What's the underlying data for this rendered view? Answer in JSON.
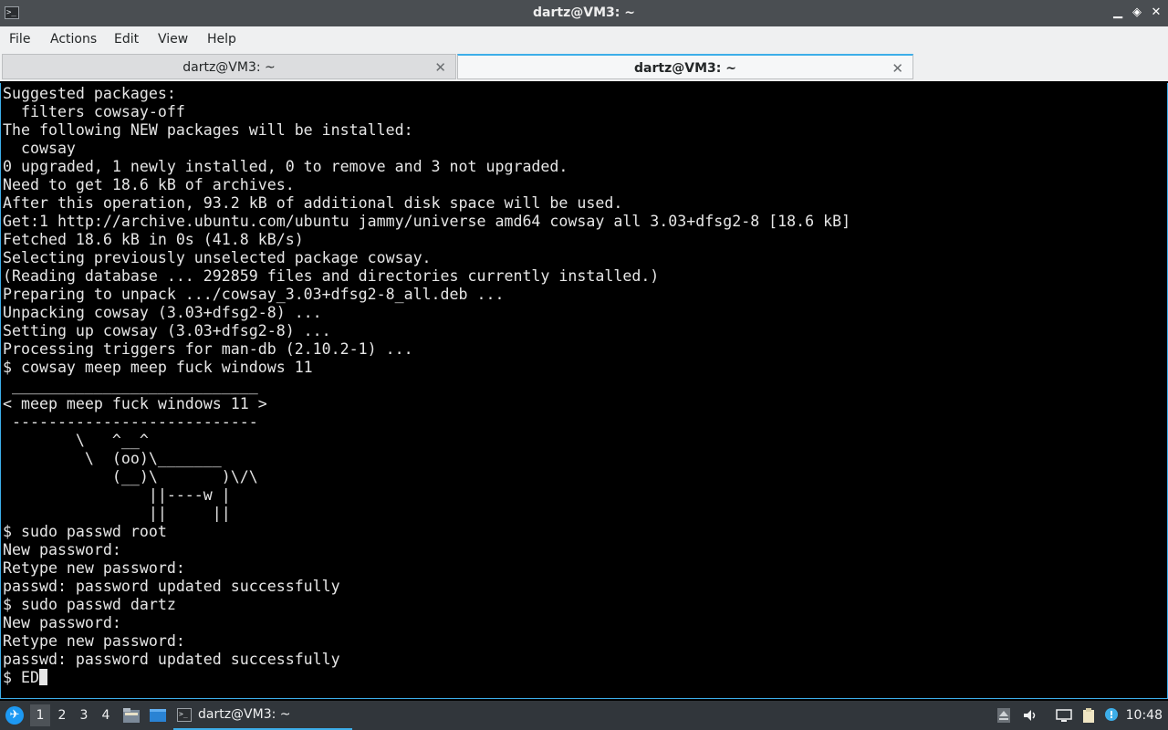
{
  "window": {
    "title": "dartz@VM3: ~",
    "icon": "terminal-icon",
    "controls": {
      "minimize": "▁",
      "restore": "◈",
      "close": "✕"
    }
  },
  "menubar": {
    "items": [
      "File",
      "Actions",
      "Edit",
      "View",
      "Help"
    ]
  },
  "tabs": [
    {
      "label": "dartz@VM3: ~",
      "active": false,
      "close": "✕"
    },
    {
      "label": "dartz@VM3: ~",
      "active": true,
      "close": "✕"
    }
  ],
  "terminal": {
    "lines": [
      "Suggested packages:",
      "  filters cowsay-off",
      "The following NEW packages will be installed:",
      "  cowsay",
      "0 upgraded, 1 newly installed, 0 to remove and 3 not upgraded.",
      "Need to get 18.6 kB of archives.",
      "After this operation, 93.2 kB of additional disk space will be used.",
      "Get:1 http://archive.ubuntu.com/ubuntu jammy/universe amd64 cowsay all 3.03+dfsg2-8 [18.6 kB]",
      "Fetched 18.6 kB in 0s (41.8 kB/s)",
      "Selecting previously unselected package cowsay.",
      "(Reading database ... 292859 files and directories currently installed.)",
      "Preparing to unpack .../cowsay_3.03+dfsg2-8_all.deb ...",
      "Unpacking cowsay (3.03+dfsg2-8) ...",
      "Setting up cowsay (3.03+dfsg2-8) ...",
      "Processing triggers for man-db (2.10.2-1) ...",
      "$ cowsay meep meep fuck windows 11",
      " ___________________________",
      "< meep meep fuck windows 11 >",
      " ---------------------------",
      "        \\   ^__^",
      "         \\  (oo)\\_______",
      "            (__)\\       )\\/\\",
      "                ||----w |",
      "                ||     ||",
      "$ sudo passwd root",
      "New password:",
      "Retype new password:",
      "passwd: password updated successfully",
      "$ sudo passwd dartz",
      "New password:",
      "Retype new password:",
      "passwd: password updated successfully"
    ],
    "prompt": "$ ED"
  },
  "taskbar": {
    "start_icon": "lubuntu-start-icon",
    "desktops": [
      "1",
      "2",
      "3",
      "4"
    ],
    "active_desktop": "1",
    "quick_launch": [
      "file-manager-icon",
      "show-desktop-icon"
    ],
    "task": {
      "label": "dartz@VM3: ~",
      "icon": "terminal-icon"
    },
    "tray": [
      "eject-icon",
      "volume-icon",
      "network-icon",
      "clipboard-icon",
      "update-notifier-icon"
    ],
    "clock": "10:48"
  }
}
